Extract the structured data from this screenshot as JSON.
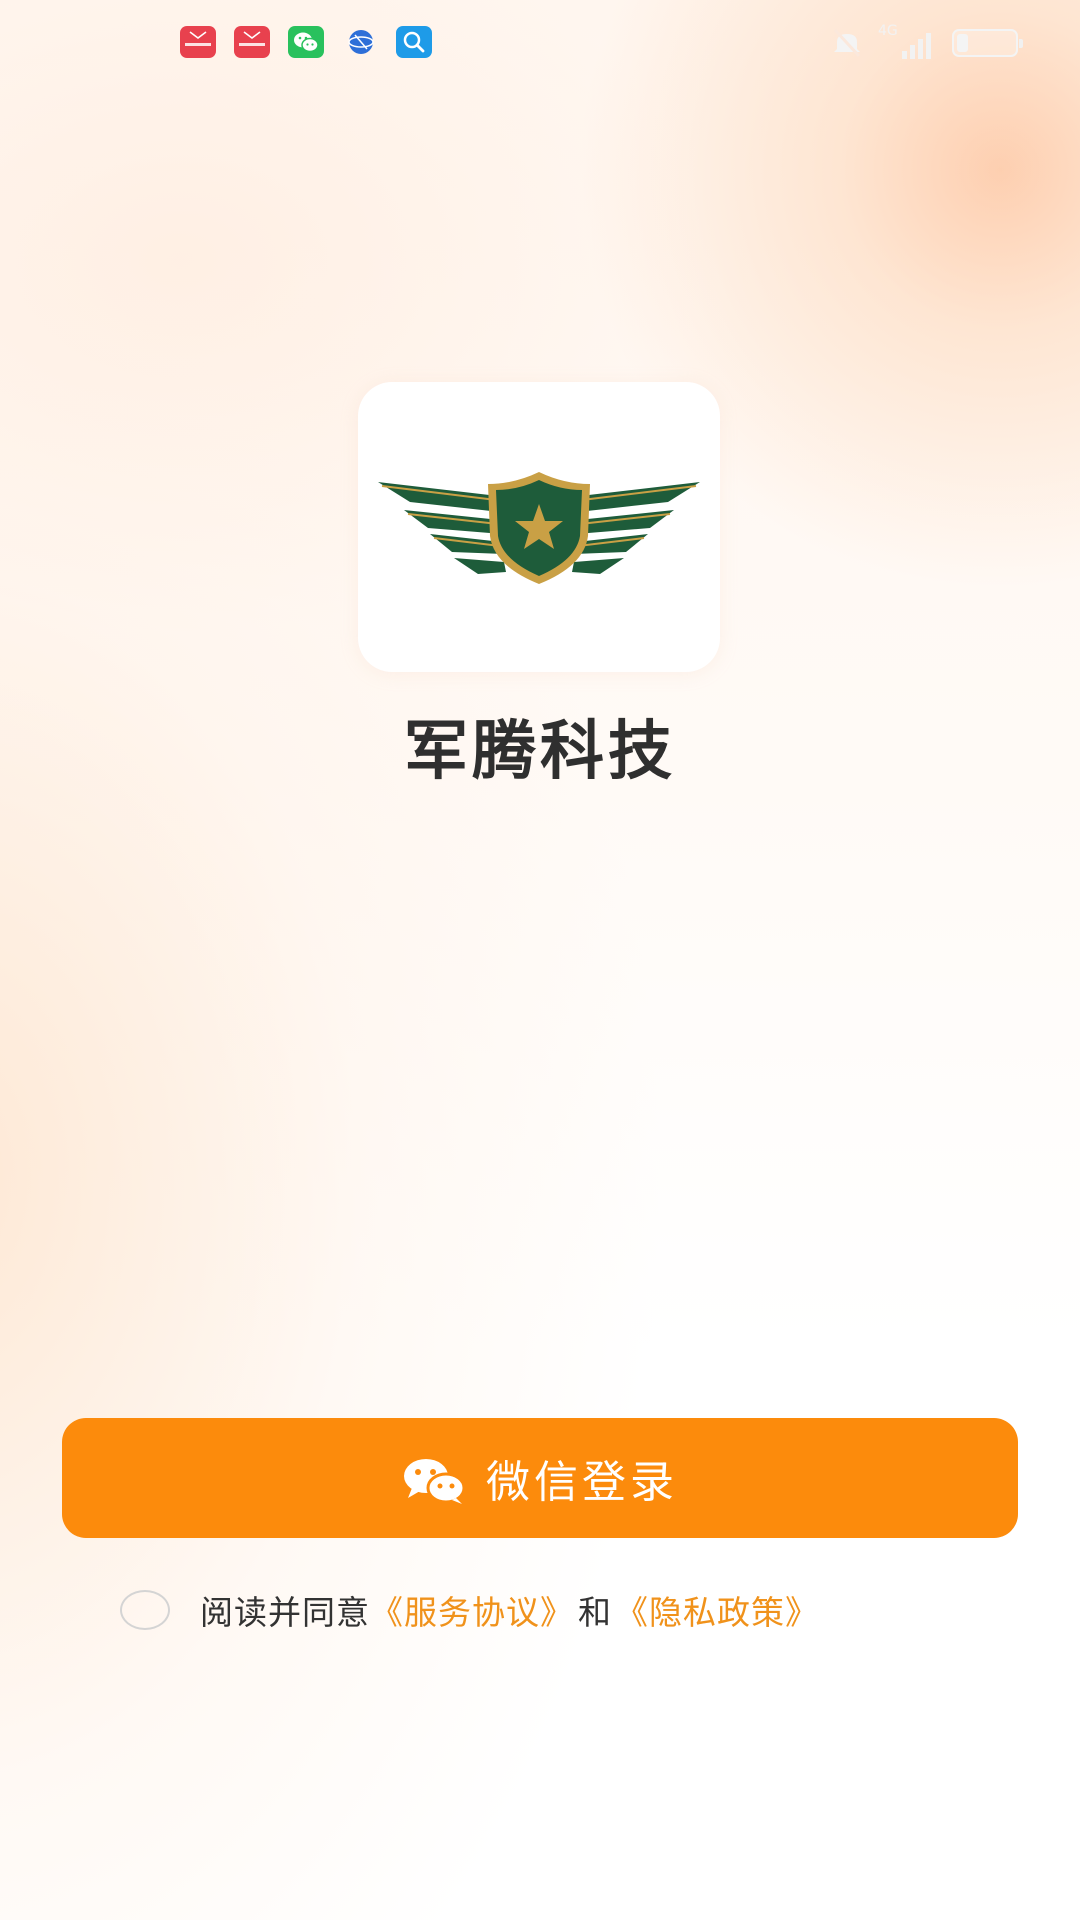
{
  "status_bar": {
    "notification_icons": [
      "mail-app-icon",
      "mail-app-icon",
      "wechat-icon",
      "globe-icon",
      "search-icon"
    ],
    "signal_label": "4G",
    "battery_level": 0.2
  },
  "app": {
    "name": "军腾科技",
    "logo_icon": "shield-wings-star-logo"
  },
  "login": {
    "button_label": "微信登录",
    "button_icon": "wechat-icon"
  },
  "agreement": {
    "prefix": "阅读并同意",
    "service_link": "《服务协议》",
    "conjunction": "和",
    "privacy_link": "《隐私政策》",
    "checked": false
  },
  "colors": {
    "primary": "#fc8b0c",
    "link": "#f0921b",
    "logo_green": "#1e5c3a",
    "logo_gold": "#c9a045",
    "title": "#2f2f2f"
  }
}
